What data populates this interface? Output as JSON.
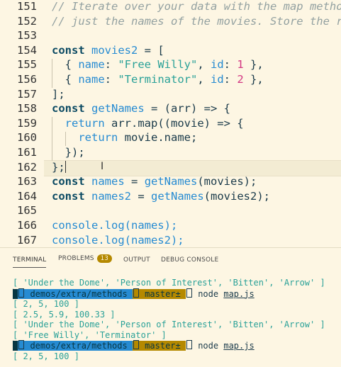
{
  "editor": {
    "line_numbers": [
      "151",
      "152",
      "153",
      "154",
      "155",
      "156",
      "157",
      "158",
      "159",
      "160",
      "161",
      "162",
      "163",
      "164",
      "165",
      "166",
      "167"
    ],
    "comment1": "// Iterate over your data with the map metho",
    "comment2": "// just the names of the movies. Store the r",
    "kw_const": "const",
    "movies2_var": "movies2",
    "assign_bracket": " = [",
    "name_key": "name",
    "id_key": "id",
    "movie1_name": "\"Free Willy\"",
    "movie1_id": "1",
    "movie2_name": "\"Terminator\"",
    "movie2_id": "2",
    "close_bracket": "];",
    "getnames_fn": "getNames",
    "getnames_sig": " = (arr) => {",
    "kw_return": "return",
    "arr_map": " arr.map((movie) => {",
    "return_expr": " movie.name;",
    "close_inner": "});",
    "close_outer": "};",
    "names_var": "names",
    "names2_var": "names2",
    "call_movies": "(movies);",
    "call_movies2": "(movies2);",
    "console_names": "console.log(names);",
    "console_names2": "console.log(names2);"
  },
  "panel": {
    "tabs": {
      "terminal": "TERMINAL",
      "problems": "PROBLEMS",
      "problems_count": "13",
      "output": "OUTPUT",
      "debug_console": "DEBUG CONSOLE"
    },
    "terminal_lines": {
      "l1": "[ 'Under the Dome', 'Person of Interest', 'Bitten', 'Arrow' ]",
      "path": " demos/extra/methods ",
      "branch": " master± ",
      "cmd": " node ",
      "file": "map.js",
      "l3": "[ 2, 5, 100 ]",
      "l4": "[ 2.5, 5.9, 100.33 ]",
      "l5": "[ 'Under the Dome', 'Person of Interest', 'Bitten', 'Arrow' ]",
      "l6": "[ 'Free Willy', 'Terminator' ]",
      "l8": "[ 2, 5, 100 ]"
    }
  }
}
